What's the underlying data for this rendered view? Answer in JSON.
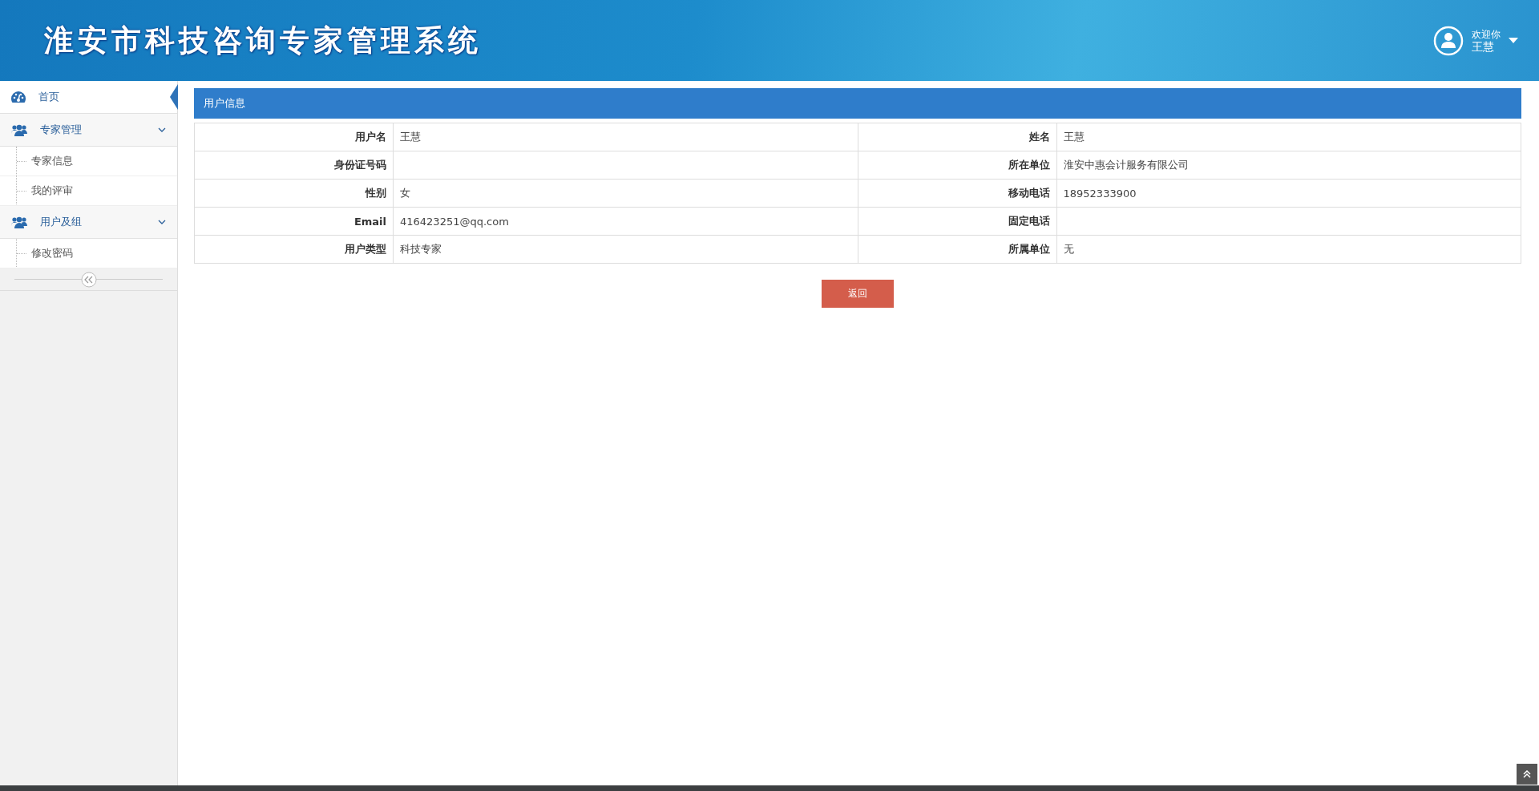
{
  "header": {
    "title": "淮安市科技咨询专家管理系统",
    "greeting": "欢迎你",
    "user_name": "王慧"
  },
  "sidebar": {
    "items": [
      {
        "label": "首页",
        "kind": "link",
        "selected": true
      },
      {
        "label": "专家管理",
        "kind": "group",
        "expanded": true,
        "selected": false,
        "children": [
          {
            "label": "专家信息",
            "selected": false
          },
          {
            "label": "我的评审",
            "selected": false
          }
        ]
      },
      {
        "label": "用户及组",
        "kind": "group",
        "expanded": true,
        "selected": false,
        "children": [
          {
            "label": "修改密码",
            "selected": false
          }
        ]
      }
    ]
  },
  "panel": {
    "title": "用户信息",
    "fields": [
      {
        "label": "用户名",
        "value": "王慧"
      },
      {
        "label": "姓名",
        "value": "王慧"
      },
      {
        "label": "身份证号码"
      },
      {
        "label": "所在单位",
        "value": "淮安中惠会计服务有限公司"
      },
      {
        "label": "性别",
        "value": "女"
      },
      {
        "label": "移动电话",
        "value": "18952333900"
      },
      {
        "label": "Email",
        "value": "416423251@qq.com"
      },
      {
        "label": "固定电话"
      },
      {
        "label": "用户类型",
        "value": "科技专家"
      },
      {
        "label": "所属单位",
        "value": "无"
      }
    ],
    "button": "返回"
  }
}
